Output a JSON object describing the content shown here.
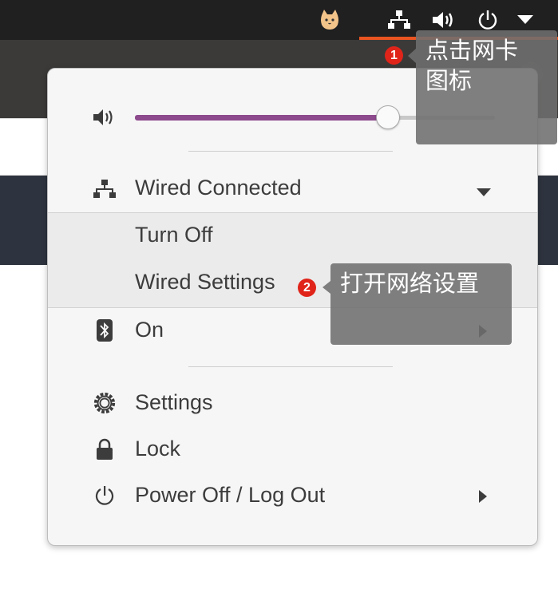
{
  "topbar": {
    "icons": [
      "cat-icon",
      "network-wired-icon",
      "volume-icon",
      "power-icon",
      "chevron-down-icon"
    ]
  },
  "menu": {
    "volume": {
      "level_percent": 70
    },
    "wired": {
      "label": "Wired Connected"
    },
    "submenu": {
      "turn_off": "Turn Off",
      "wired_settings": "Wired Settings"
    },
    "bluetooth": {
      "label": "On"
    },
    "settings": {
      "label": "Settings"
    },
    "lock": {
      "label": "Lock"
    },
    "power": {
      "label": "Power Off / Log Out"
    }
  },
  "annotations": {
    "step1": {
      "number": "1",
      "text_line1": "点击网卡",
      "text_line2": "图标"
    },
    "step2": {
      "number": "2",
      "text": "打开网络设置"
    }
  },
  "colors": {
    "accent": "#e95420",
    "slider": "#8d4a8d",
    "badge": "#e0241a"
  }
}
